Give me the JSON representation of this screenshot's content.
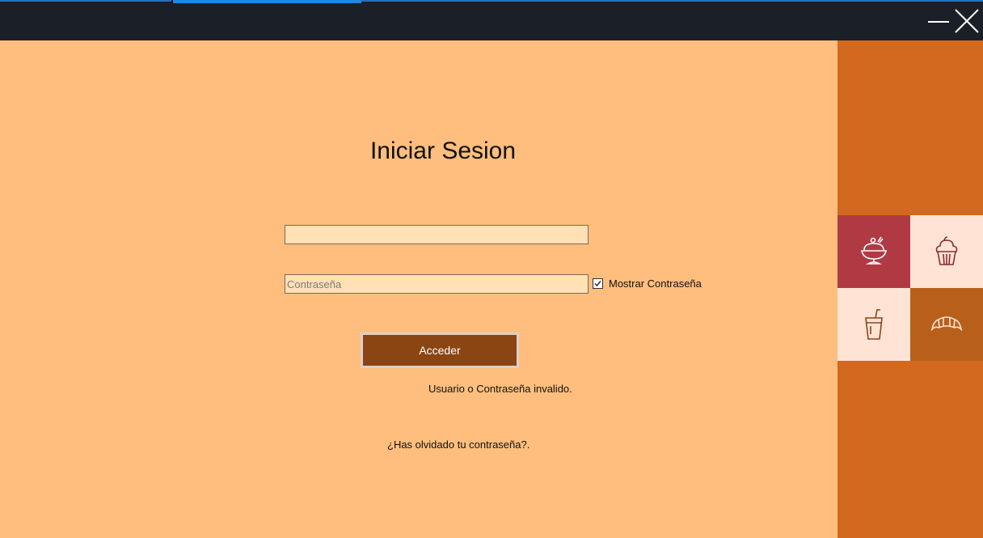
{
  "window": {
    "minimize_icon": "minimize-icon",
    "close_icon": "close-icon"
  },
  "login": {
    "title": "Iniciar Sesion",
    "username": {
      "value": "",
      "placeholder": ""
    },
    "password": {
      "value": "",
      "placeholder": "Contraseña"
    },
    "show_password": {
      "label": "Mostrar Contraseña",
      "checked": true
    },
    "submit_label": "Acceder",
    "error_message": "Usuario o Contraseña invalido.",
    "forgot_link": "¿Has olvidado tu contraseña?."
  },
  "sidebar": {
    "tiles": [
      {
        "icon": "ice-cream-sundae-icon",
        "color": "#b03a44"
      },
      {
        "icon": "cupcake-icon",
        "color": "#ffe4d6"
      },
      {
        "icon": "drink-cup-icon",
        "color": "#ffe4d6"
      },
      {
        "icon": "croissant-icon",
        "color": "#b8601a"
      }
    ]
  },
  "colors": {
    "background": "#ffbe7d",
    "sidebar": "#d2691e",
    "titlebar": "#1b1f27",
    "button": "#8b4513"
  }
}
